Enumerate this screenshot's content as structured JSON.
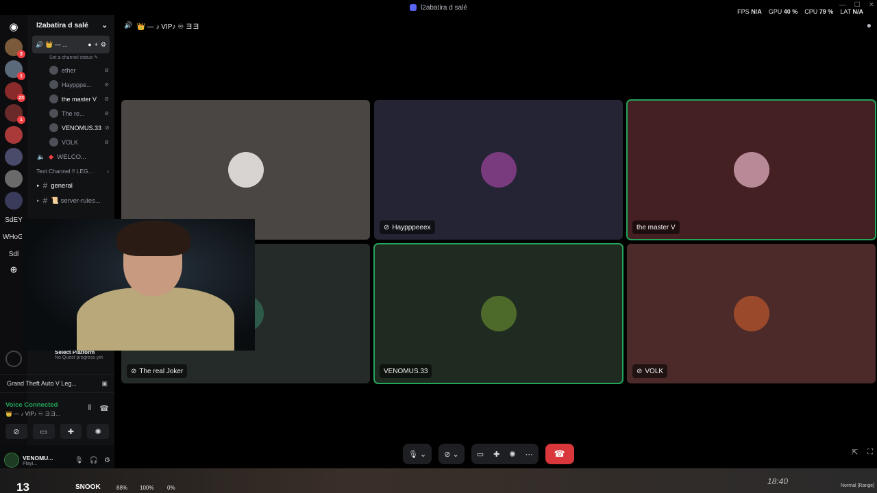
{
  "window": {
    "title": "l2abatira d salé"
  },
  "overlay": {
    "fps_label": "FPS",
    "fps": "N/A",
    "gpu_label": "GPU",
    "gpu": "40 %",
    "cpu_label": "CPU",
    "cpu": "79 %",
    "lat_label": "LAT",
    "lat": "N/A"
  },
  "rail": {
    "servers": [
      {
        "badge": "3"
      },
      {
        "badge": "1"
      },
      {
        "badge": "23"
      },
      {
        "badge": "1"
      },
      {
        "badge": ""
      },
      {
        "badge": ""
      },
      {
        "badge": ""
      },
      {
        "badge": ""
      }
    ],
    "text_servers": [
      "SdEY",
      "WHoGl",
      "Sdl"
    ]
  },
  "sidebar": {
    "server_name": "l2abatira d salé",
    "voice_channel": {
      "name": "👑 — ...",
      "status_placeholder": "Set a channel status ✎"
    },
    "members": [
      {
        "name": "ether",
        "bright": false
      },
      {
        "name": "Haypppe...",
        "bright": false
      },
      {
        "name": "the master V",
        "bright": true
      },
      {
        "name": "The re...",
        "bright": false
      },
      {
        "name": "VENOMUS.33",
        "bright": true
      },
      {
        "name": "VOLK",
        "bright": false
      }
    ],
    "welcome_channel": "WELCO...",
    "category": "Text Channel ‼ LEG...",
    "channels": [
      {
        "name": "general",
        "active": true
      },
      {
        "name": "📜 server-rules...",
        "active": false
      }
    ],
    "quest": {
      "title": "Select Platform",
      "subtitle": "No Quest progress yet"
    },
    "activity": "Grand Theft Auto V Leg...",
    "voice": {
      "status": "Voice Connected",
      "channel": "👑 — ♪ VIP♪ ♾ ヨヨ..."
    },
    "user": {
      "name": "VENOMU...",
      "status": "Playi..."
    }
  },
  "main": {
    "channel_title": "👑 — ♪ VIP♪ ♾ ヨヨ",
    "tiles": [
      {
        "name": "",
        "bg": "#4a4644",
        "avatar": "#d8d4d2",
        "speaking": false,
        "muted": false
      },
      {
        "name": "Haypppeeex",
        "bg": "#242434",
        "avatar": "#7a3a7e",
        "speaking": false,
        "muted": true
      },
      {
        "name": "the master V",
        "bg": "#452022",
        "avatar": "#b88a98",
        "speaking": true,
        "muted": false
      },
      {
        "name": "The real Joker",
        "bg": "#242b29",
        "avatar": "#2e5a4a",
        "speaking": false,
        "muted": true
      },
      {
        "name": "VENOMUS.33",
        "bg": "#1f2a20",
        "avatar": "#4e6a2a",
        "speaking": true,
        "muted": false
      },
      {
        "name": "VOLK",
        "bg": "#4c2a2a",
        "avatar": "#9a4a2a",
        "speaking": false,
        "muted": true
      }
    ]
  },
  "taskbar": {
    "number": "13",
    "game": "SNOOK",
    "pct1": "88%",
    "pct2": "100%",
    "pct3": "0%",
    "time": "18:40",
    "mode": "Normal [Range]"
  }
}
